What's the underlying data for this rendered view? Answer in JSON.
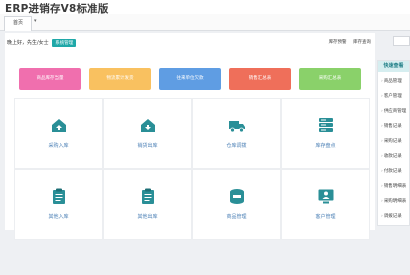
{
  "app": {
    "title": "ERP进销存V8标准版"
  },
  "tabs": [
    {
      "label": "首页"
    }
  ],
  "tab_dropdown": "▾",
  "greeting": {
    "text": "晚上好，先生/女士",
    "badge": "系统管理"
  },
  "util_links": [
    "库存预警",
    "库存查询"
  ],
  "summary_tiles": [
    {
      "label": "商品库存当量",
      "color": "#f06fae"
    },
    {
      "label": "物流累计发货",
      "color": "#f9c160"
    },
    {
      "label": "往来单位欠款",
      "color": "#5f9de3"
    },
    {
      "label": "销售汇总表",
      "color": "#ef6f5a"
    },
    {
      "label": "采购汇总表",
      "color": "#8ad16a"
    }
  ],
  "actions": [
    {
      "label": "采购入库",
      "icon": "house-upload-icon"
    },
    {
      "label": "销货出库",
      "icon": "house-download-icon"
    },
    {
      "label": "仓库调拨",
      "icon": "truck-icon"
    },
    {
      "label": "库存盘点",
      "icon": "server-stack-icon"
    },
    {
      "label": "其他入库",
      "icon": "clipboard-in-icon"
    },
    {
      "label": "其他出库",
      "icon": "clipboard-out-icon"
    },
    {
      "label": "商品管理",
      "icon": "box-stack-icon"
    },
    {
      "label": "客户管理",
      "icon": "person-card-icon"
    }
  ],
  "quickbar": {
    "title": "快速查看",
    "items": [
      "商品管理",
      "客户管理",
      "供应商管理",
      "销售记录",
      "采购记录",
      "收款记录",
      "付款记录",
      "销售明细表",
      "采购明细表",
      "调拨记录"
    ]
  },
  "colors": {
    "accent": "#1fa8a8",
    "icon": "#2a8f97",
    "link": "#4a7fb5"
  }
}
